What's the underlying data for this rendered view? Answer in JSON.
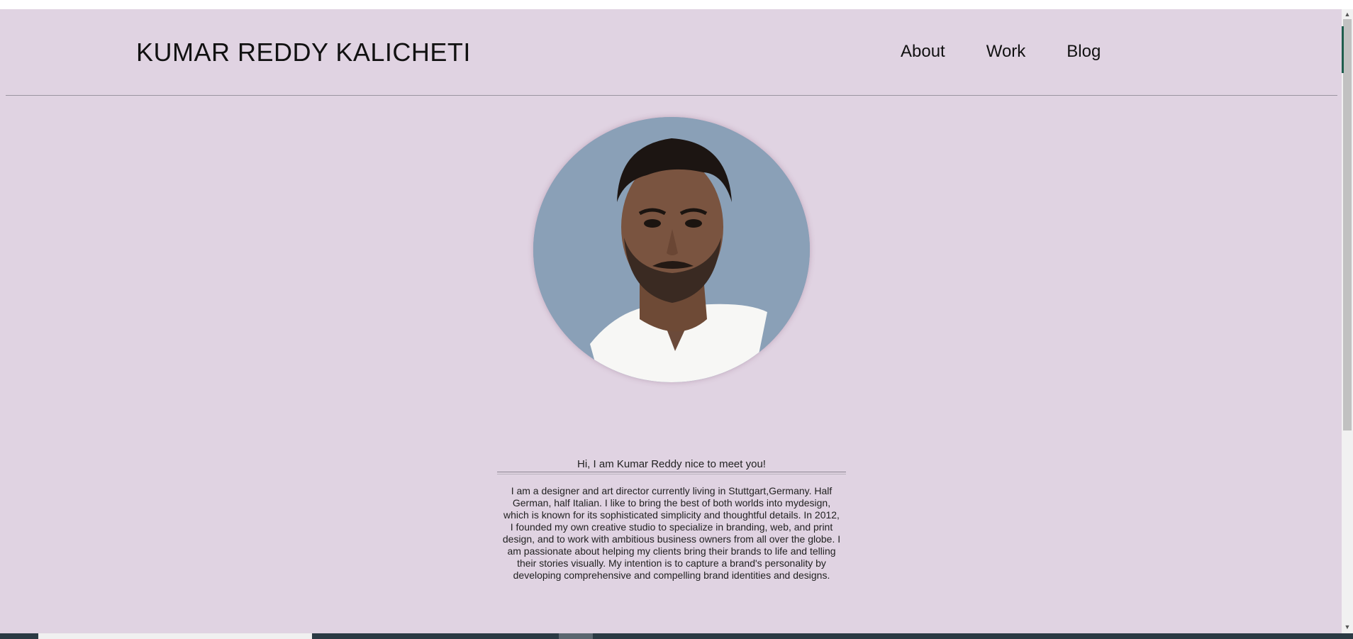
{
  "header": {
    "site_title": "KUMAR REDDY KALICHETI",
    "nav": [
      {
        "label": "About"
      },
      {
        "label": "Work"
      },
      {
        "label": "Blog"
      }
    ]
  },
  "profile": {
    "photo_alt": "Profile photo"
  },
  "about": {
    "greeting": "Hi, I am Kumar Reddy nice to meet you!",
    "bio_lines": [
      "I am a designer and art director currently living in Stuttgart,Germany. Half",
      "German, half Italian. I like to bring the best of both worlds into mydesign,",
      "which is known for its sophisticated simplicity and thoughtful details. In 2012,",
      "I founded my own creative studio to specialize in branding, web, and print",
      "design, and to work with ambitious business owners from all over the globe. I",
      "am passionate about helping my clients bring their brands to life and telling",
      "their stories visually. My intention is to capture a brand's personality by",
      "developing comprehensive and compelling brand identities and designs."
    ]
  },
  "colors": {
    "page_background": "#e0d3e2",
    "avatar_background": "#8aa0b7",
    "text": "#111111"
  },
  "icons": {
    "scroll_up": "triangle-up-icon",
    "scroll_down": "triangle-down-icon"
  }
}
